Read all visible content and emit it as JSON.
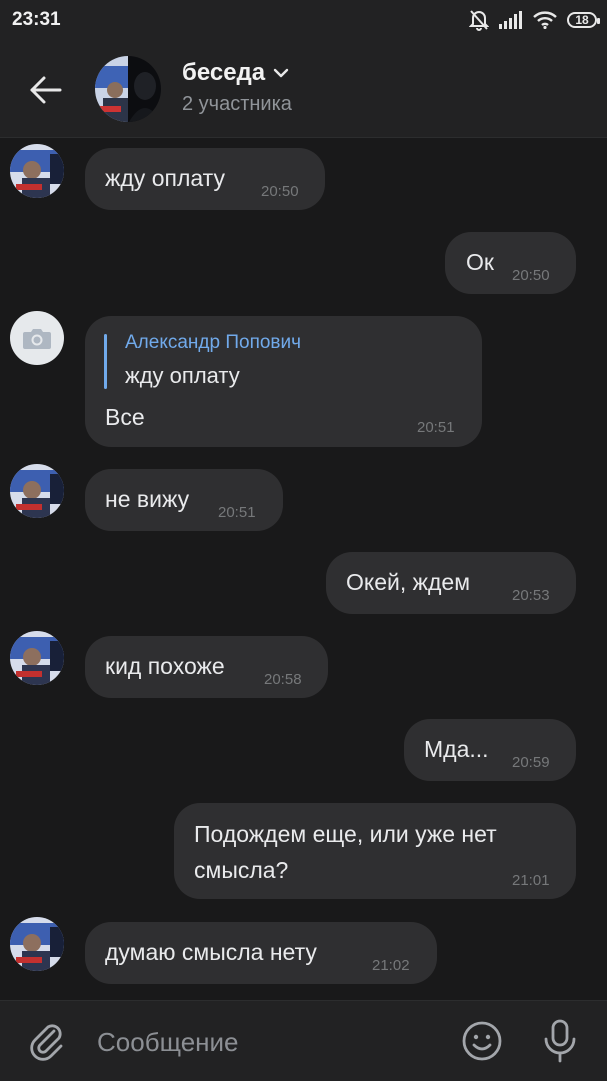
{
  "status_bar": {
    "time": "23:31",
    "battery": "18"
  },
  "header": {
    "title": "беседа",
    "subtitle": "2 участника"
  },
  "messages": [
    {
      "text": "жду оплату",
      "time": "20:50"
    },
    {
      "text": "Ок",
      "time": "20:50"
    },
    {
      "reply_author": "Александр Попович",
      "reply_text": "жду оплату",
      "text": "Все",
      "time": "20:51"
    },
    {
      "text": "не вижу",
      "time": "20:51"
    },
    {
      "text": "Окей,  ждем",
      "time": "20:53"
    },
    {
      "text": "кид похоже",
      "time": "20:58"
    },
    {
      "text": "Мда...",
      "time": "20:59"
    },
    {
      "text_line1": "Подождем еще,  или уже нет",
      "text_line2": "смысла?",
      "time": "21:01"
    },
    {
      "text": "думаю смысла нету",
      "time": "21:02"
    }
  ],
  "input": {
    "placeholder": "Сообщение"
  },
  "colors": {
    "background": "#19191a",
    "bubble": "#2f2f31",
    "accent": "#71aaeb",
    "header": "#222223"
  }
}
